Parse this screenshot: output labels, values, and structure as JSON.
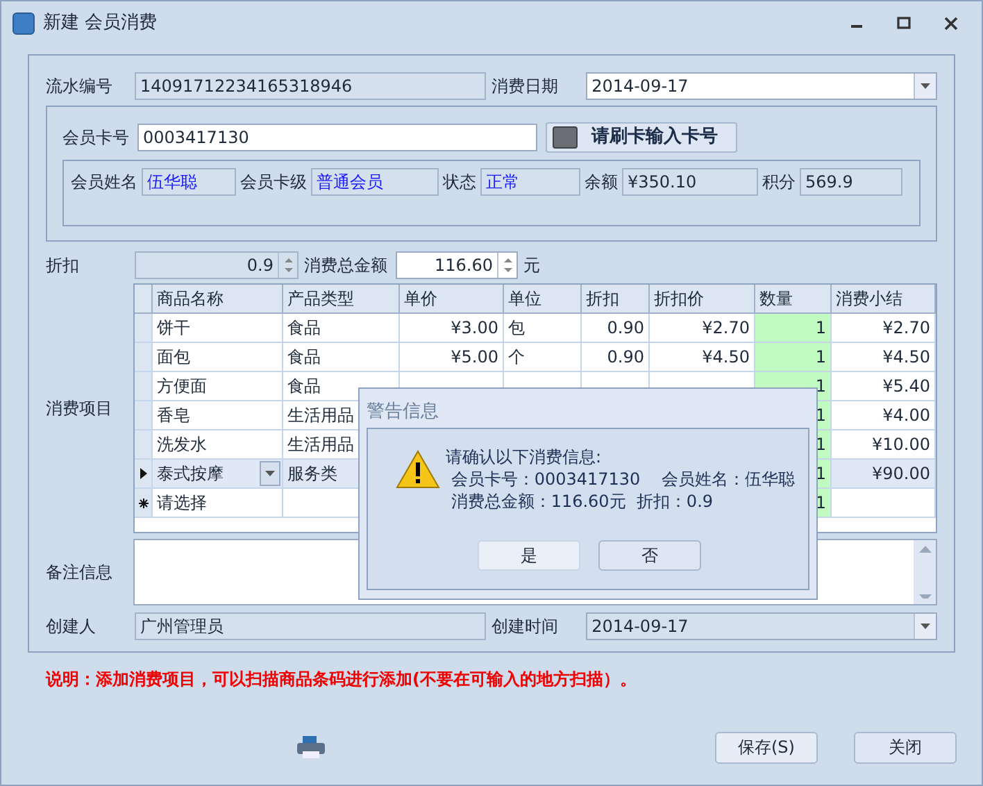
{
  "window": {
    "title": "新建 会员消费"
  },
  "serial": {
    "label": "流水编号",
    "value": "14091712234165318946"
  },
  "date": {
    "label": "消费日期",
    "value": "2014-09-17"
  },
  "card": {
    "label": "会员卡号",
    "value": "0003417130",
    "button": "请刷卡输入卡号"
  },
  "member_fields": [
    {
      "label": "会员姓名",
      "value": "伍华聪",
      "emphasis": true
    },
    {
      "label": "会员卡级",
      "value": "普通会员",
      "emphasis": true
    },
    {
      "label": "状态",
      "value": "正常",
      "emphasis": true
    },
    {
      "label": "余额",
      "value": "¥350.10",
      "emphasis": false
    },
    {
      "label": "积分",
      "value": "569.9",
      "emphasis": false
    }
  ],
  "discount": {
    "label": "折扣",
    "value": "0.9"
  },
  "total": {
    "label": "消费总金额",
    "value": "116.60",
    "unit": "元"
  },
  "items_label": "消费项目",
  "table": {
    "columns": [
      "商品名称",
      "产品类型",
      "单价",
      "单位",
      "折扣",
      "折扣价",
      "数量",
      "消费小结"
    ],
    "rows": [
      {
        "kind": "normal",
        "cells": {
          "name": "饼干",
          "type": "食品",
          "price": "¥3.00",
          "unit": "包",
          "discount": "0.90",
          "discounted_price": "¥2.70",
          "quantity": "1",
          "subtotal": "¥2.70"
        }
      },
      {
        "kind": "normal",
        "cells": {
          "name": "面包",
          "type": "食品",
          "price": "¥5.00",
          "unit": "个",
          "discount": "0.90",
          "discounted_price": "¥4.50",
          "quantity": "1",
          "subtotal": "¥4.50"
        }
      },
      {
        "kind": "normal",
        "cells": {
          "name": "方便面",
          "type": "食品",
          "quantity": "1",
          "subtotal": "¥5.40"
        }
      },
      {
        "kind": "normal",
        "cells": {
          "name": "香皂",
          "type": "生活用品",
          "quantity": "1",
          "subtotal": "¥4.00"
        }
      },
      {
        "kind": "normal",
        "cells": {
          "name": "洗发水",
          "type": "生活用品",
          "quantity": "1",
          "subtotal": "¥10.00"
        }
      },
      {
        "kind": "current",
        "cells": {
          "name": "泰式按摩",
          "type": "服务类",
          "quantity": "1",
          "subtotal": "¥90.00"
        }
      },
      {
        "kind": "new",
        "cells": {
          "name": "请选择",
          "quantity": "1"
        }
      }
    ]
  },
  "remarks": {
    "label": "备注信息"
  },
  "creator": {
    "label": "创建人",
    "value": "广州管理员"
  },
  "created": {
    "label": "创建时间",
    "value": "2014-09-17"
  },
  "note": "说明：添加消费项目，可以扫描商品条码进行添加(不要在可输入的地方扫描）。",
  "buttons": {
    "save": "保存(S)",
    "close": "关闭"
  },
  "dialog": {
    "title": "警告信息",
    "lines": [
      "请确认以下消费信息:",
      " 会员卡号：0003417130    会员姓名：伍华聪",
      " 消费总金额：116.60元  折扣：0.9"
    ],
    "buttons": [
      "是",
      "否"
    ]
  }
}
